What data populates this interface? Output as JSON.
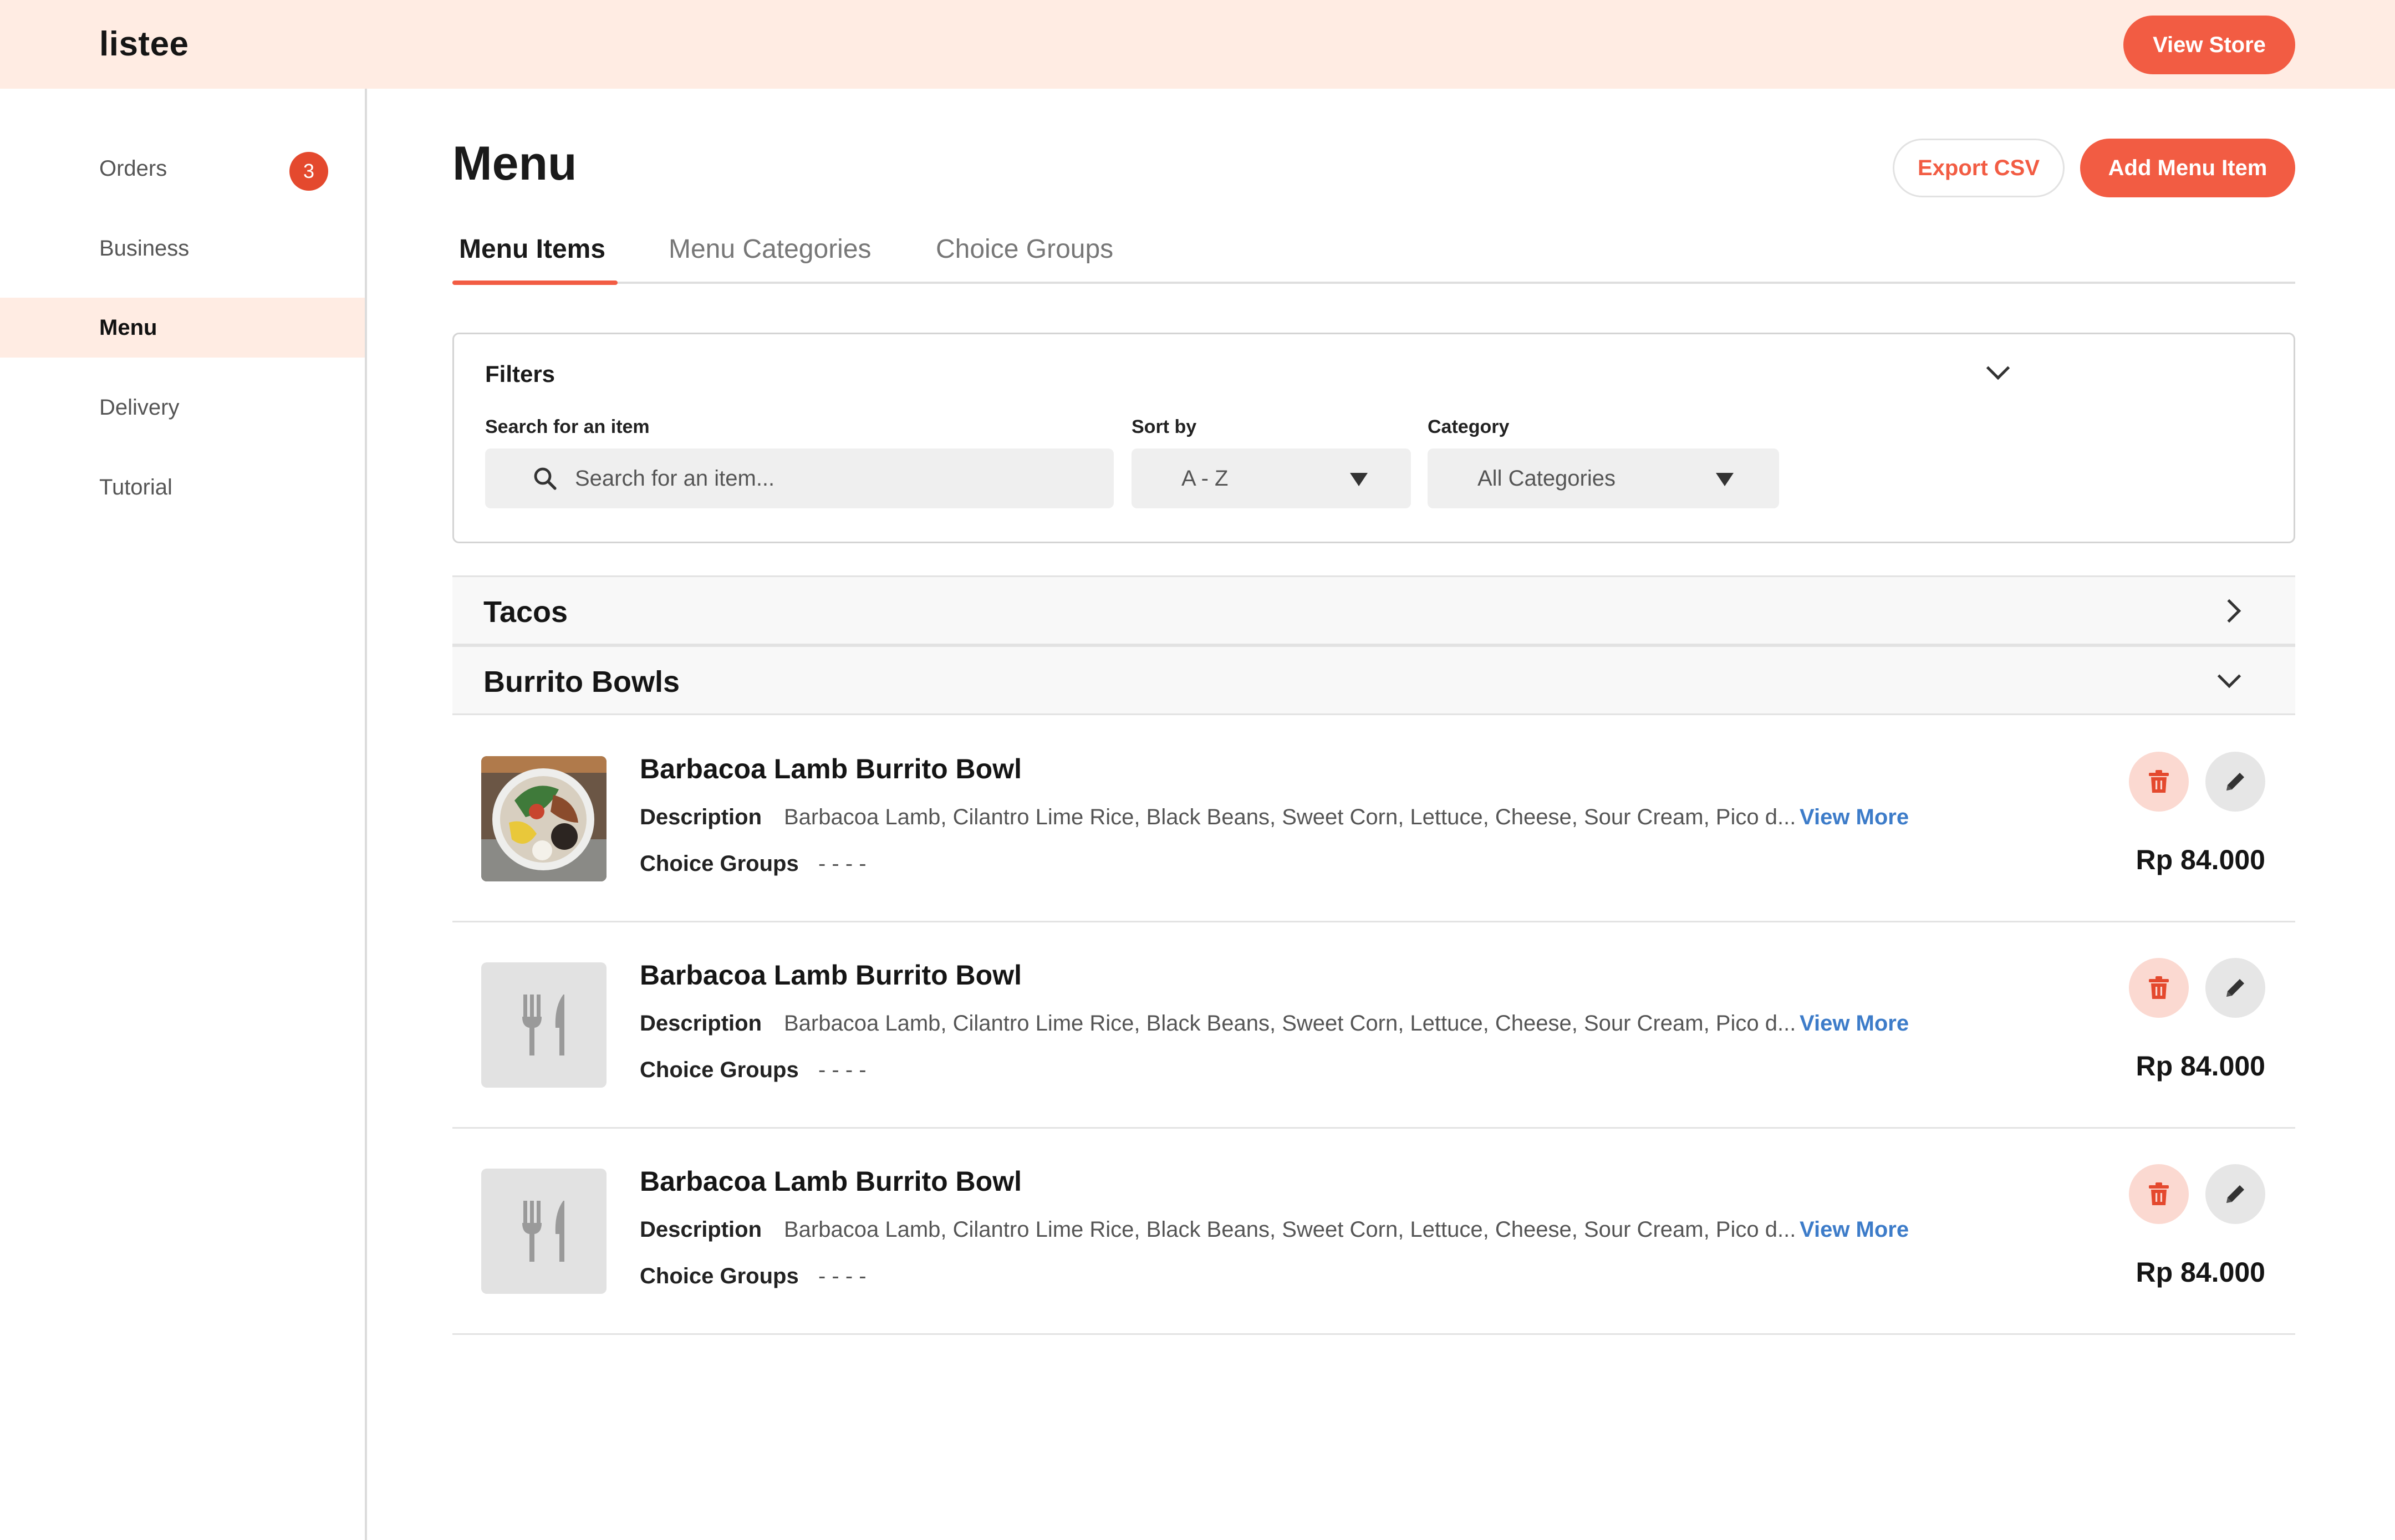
{
  "app": {
    "logo": "listee",
    "view_store": "View Store"
  },
  "sidebar": {
    "items": [
      {
        "label": "Orders",
        "badge": "3"
      },
      {
        "label": "Business"
      },
      {
        "label": "Menu"
      },
      {
        "label": "Delivery"
      },
      {
        "label": "Tutorial"
      }
    ],
    "active": "Menu"
  },
  "page": {
    "title": "Menu",
    "export_csv": "Export CSV",
    "add_item": "Add Menu Item"
  },
  "tabs": [
    {
      "label": "Menu Items",
      "active": true
    },
    {
      "label": "Menu Categories"
    },
    {
      "label": "Choice Groups"
    }
  ],
  "filters": {
    "title": "Filters",
    "search": {
      "label": "Search for an item",
      "placeholder": "Search for an item..."
    },
    "sort": {
      "label": "Sort by",
      "value": "A - Z"
    },
    "category": {
      "label": "Category",
      "value": "All Categories"
    }
  },
  "categories": [
    {
      "name": "Tacos",
      "expanded": false
    },
    {
      "name": "Burrito Bowls",
      "expanded": true
    }
  ],
  "items": [
    {
      "name": "Barbacoa Lamb Burrito Bowl",
      "description_label": "Description",
      "description": "Barbacoa Lamb, Cilantro Lime Rice, Black Beans, Sweet Corn, Lettuce, Cheese, Sour Cream, Pico d...",
      "view_more": "View More",
      "choice_groups_label": "Choice Groups",
      "choice_groups": "- - - -",
      "price": "Rp 84.000",
      "image": "photo"
    },
    {
      "name": "Barbacoa Lamb Burrito Bowl",
      "description_label": "Description",
      "description": "Barbacoa Lamb, Cilantro Lime Rice, Black Beans, Sweet Corn, Lettuce, Cheese, Sour Cream, Pico d...",
      "view_more": "View More",
      "choice_groups_label": "Choice Groups",
      "choice_groups": "- - - -",
      "price": "Rp 84.000",
      "image": "placeholder"
    },
    {
      "name": "Barbacoa Lamb Burrito Bowl",
      "description_label": "Description",
      "description": "Barbacoa Lamb, Cilantro Lime Rice, Black Beans, Sweet Corn, Lettuce, Cheese, Sour Cream, Pico d...",
      "view_more": "View More",
      "choice_groups_label": "Choice Groups",
      "choice_groups": "- - - -",
      "price": "Rp 84.000",
      "image": "placeholder"
    }
  ],
  "colors": {
    "accent": "#f25c43",
    "header_bg": "#ffece3",
    "link": "#3d7cc9"
  }
}
